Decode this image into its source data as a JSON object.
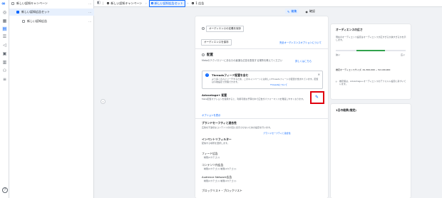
{
  "rail": {
    "logo": "∞",
    "icons": [
      "grid-icon",
      "chart-icon",
      "table-icon",
      "list-icon",
      "megaphone-icon",
      "layers-icon",
      "library-icon",
      "people-icon",
      "menu-icon"
    ]
  },
  "tree": {
    "items": [
      {
        "label": "新しい認知キャンペーン"
      },
      {
        "label": "新しい認知広告セット"
      },
      {
        "label": "新しい認知広告"
      }
    ]
  },
  "topbar": {
    "crumbs": [
      {
        "label": "新しい認知キャンペーン"
      },
      {
        "label": "新しい認知広告セット"
      },
      {
        "label": "1 広告"
      }
    ]
  },
  "modes": {
    "edit": "編集",
    "review": "確認"
  },
  "main": {
    "audience_btn": "オーディエンスの定義を保存",
    "save_audience_btn": "オーディエンスを保存",
    "audience_option_link": "完全オーディエンスオプションについて",
    "placement_title": "配置",
    "placement_desc": "Metaのテクノロジーにあなたの最適な広告を配信する場所を教えてください",
    "placement_link": "詳しくはこちら",
    "notice_title": "Threadsフィード配置を含む",
    "notice_body": "より多くの人にリーチするため、このキャンペーンには新しいThreadsフィードの配置が含まれています。配置は今後設定で管理できます。",
    "notice_link": "Threadsについて",
    "adv_placement": "Advantage+ 配置",
    "adv_desc": "Meta配置オプションを使用すると、利用可能な予算の中で広告がパフォーマンスを発揮しやすくなります。",
    "show_options": "オプションを表示",
    "brand_safety": "ブランドセーフティと適合性",
    "brand_safety_desc": "広告を不適切なコンテンツの付近に表示させないための設定を行います。",
    "brand_safety_link": "ブランドセーフティと適合性",
    "inventory_filter": "インベントリフィルター",
    "inventory_desc": "配信する場所を選択します。",
    "feed": "フィード広告",
    "feed_value": "制限(2カテゴリ)",
    "in_content": "コンテンツ内広告",
    "in_content_value": "制限(2カテゴリ) 制限(2カテゴリ)",
    "audience_network": "Audience Network広告",
    "audience_network_value": "制限(2カテゴリ) 制限(2カテゴリ)",
    "blocklist": "ブロックリスト・ブロックリスト"
  },
  "side": {
    "audience_size_title": "オーディエンスの広さ",
    "audience_size_desc": "現在のオーディエンス設定はオーディエンスが広すぎるか狭すぎるかを示します。",
    "narrow": "狭い",
    "broad": "広い",
    "estimate": "推定オーディエンスサイズ: 41,300,000 ~ 52,100,000",
    "estimate_note": "推定値は、Advantage+オーディエンスのデフォルト設定に基づいています。",
    "results_title": "1日の結果(推定)"
  }
}
